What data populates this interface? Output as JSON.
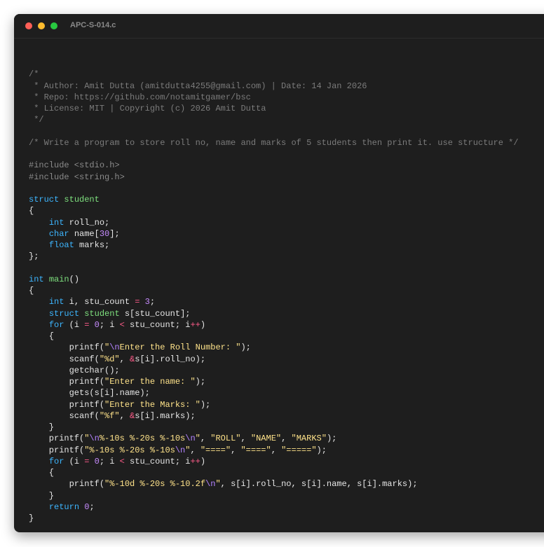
{
  "window": {
    "title": "APC-S-014.c",
    "colors": {
      "background": "#1e1e1e",
      "comment": "#7b7b7b",
      "keyword": "#3db6ff",
      "type_name": "#7ee07e",
      "number": "#c78cff",
      "operator": "#ff5c8a",
      "string": "#ffe38a",
      "escape": "#b483ff"
    }
  },
  "code_lines": [
    [],
    [
      [
        "cmt",
        "/*"
      ]
    ],
    [
      [
        "cmt",
        " * Author: Amit Dutta (amitdutta4255@gmail.com) | Date: 14 Jan 2026"
      ]
    ],
    [
      [
        "cmt",
        " * Repo: https://github.com/notamitgamer/bsc"
      ]
    ],
    [
      [
        "cmt",
        " * License: MIT | Copyright (c) 2026 Amit Dutta"
      ]
    ],
    [
      [
        "cmt",
        " */"
      ]
    ],
    [],
    [
      [
        "cmt",
        "/* Write a program to store roll no, name and marks of 5 students then print it. use structure */"
      ]
    ],
    [],
    [
      [
        "pp",
        "#include <stdio.h>"
      ]
    ],
    [
      [
        "pp",
        "#include <string.h>"
      ]
    ],
    [],
    [
      [
        "kw",
        "struct"
      ],
      [
        "plain",
        " "
      ],
      [
        "ty",
        "student"
      ]
    ],
    [
      [
        "plain",
        "{"
      ]
    ],
    [
      [
        "plain",
        "    "
      ],
      [
        "kw",
        "int"
      ],
      [
        "plain",
        " roll_no;"
      ]
    ],
    [
      [
        "plain",
        "    "
      ],
      [
        "kw",
        "char"
      ],
      [
        "plain",
        " name["
      ],
      [
        "num",
        "30"
      ],
      [
        "plain",
        "];"
      ]
    ],
    [
      [
        "plain",
        "    "
      ],
      [
        "kw",
        "float"
      ],
      [
        "plain",
        " marks;"
      ]
    ],
    [
      [
        "plain",
        "};"
      ]
    ],
    [],
    [
      [
        "kw",
        "int"
      ],
      [
        "plain",
        " "
      ],
      [
        "fn",
        "main"
      ],
      [
        "plain",
        "()"
      ]
    ],
    [
      [
        "plain",
        "{"
      ]
    ],
    [
      [
        "plain",
        "    "
      ],
      [
        "kw",
        "int"
      ],
      [
        "plain",
        " i, stu_count "
      ],
      [
        "op",
        "="
      ],
      [
        "plain",
        " "
      ],
      [
        "num",
        "3"
      ],
      [
        "plain",
        ";"
      ]
    ],
    [
      [
        "plain",
        "    "
      ],
      [
        "kw",
        "struct"
      ],
      [
        "plain",
        " "
      ],
      [
        "ty",
        "student"
      ],
      [
        "plain",
        " s[stu_count];"
      ]
    ],
    [
      [
        "plain",
        "    "
      ],
      [
        "kw",
        "for"
      ],
      [
        "plain",
        " (i "
      ],
      [
        "op",
        "="
      ],
      [
        "plain",
        " "
      ],
      [
        "num",
        "0"
      ],
      [
        "plain",
        "; i "
      ],
      [
        "op",
        "<"
      ],
      [
        "plain",
        " stu_count; i"
      ],
      [
        "op",
        "++"
      ],
      [
        "plain",
        ")"
      ]
    ],
    [
      [
        "plain",
        "    {"
      ]
    ],
    [
      [
        "plain",
        "        printf("
      ],
      [
        "str",
        "\""
      ],
      [
        "esc",
        "\\n"
      ],
      [
        "str",
        "Enter the Roll Number: \""
      ],
      [
        "plain",
        ");"
      ]
    ],
    [
      [
        "plain",
        "        scanf("
      ],
      [
        "str",
        "\"%d\""
      ],
      [
        "plain",
        ", "
      ],
      [
        "op",
        "&"
      ],
      [
        "plain",
        "s[i].roll_no);"
      ]
    ],
    [
      [
        "plain",
        "        getchar();"
      ]
    ],
    [
      [
        "plain",
        "        printf("
      ],
      [
        "str",
        "\"Enter the name: \""
      ],
      [
        "plain",
        ");"
      ]
    ],
    [
      [
        "plain",
        "        gets(s[i].name);"
      ]
    ],
    [
      [
        "plain",
        "        printf("
      ],
      [
        "str",
        "\"Enter the Marks: \""
      ],
      [
        "plain",
        ");"
      ]
    ],
    [
      [
        "plain",
        "        scanf("
      ],
      [
        "str",
        "\"%f\""
      ],
      [
        "plain",
        ", "
      ],
      [
        "op",
        "&"
      ],
      [
        "plain",
        "s[i].marks);"
      ]
    ],
    [
      [
        "plain",
        "    }"
      ]
    ],
    [
      [
        "plain",
        "    printf("
      ],
      [
        "str",
        "\""
      ],
      [
        "esc",
        "\\n"
      ],
      [
        "str",
        "%-10s %-20s %-10s"
      ],
      [
        "esc",
        "\\n"
      ],
      [
        "str",
        "\""
      ],
      [
        "plain",
        ", "
      ],
      [
        "str",
        "\"ROLL\""
      ],
      [
        "plain",
        ", "
      ],
      [
        "str",
        "\"NAME\""
      ],
      [
        "plain",
        ", "
      ],
      [
        "str",
        "\"MARKS\""
      ],
      [
        "plain",
        ");"
      ]
    ],
    [
      [
        "plain",
        "    printf("
      ],
      [
        "str",
        "\"%-10s %-20s %-10s"
      ],
      [
        "esc",
        "\\n"
      ],
      [
        "str",
        "\""
      ],
      [
        "plain",
        ", "
      ],
      [
        "str",
        "\"====\""
      ],
      [
        "plain",
        ", "
      ],
      [
        "str",
        "\"====\""
      ],
      [
        "plain",
        ", "
      ],
      [
        "str",
        "\"=====\""
      ],
      [
        "plain",
        ");"
      ]
    ],
    [
      [
        "plain",
        "    "
      ],
      [
        "kw",
        "for"
      ],
      [
        "plain",
        " (i "
      ],
      [
        "op",
        "="
      ],
      [
        "plain",
        " "
      ],
      [
        "num",
        "0"
      ],
      [
        "plain",
        "; i "
      ],
      [
        "op",
        "<"
      ],
      [
        "plain",
        " stu_count; i"
      ],
      [
        "op",
        "++"
      ],
      [
        "plain",
        ")"
      ]
    ],
    [
      [
        "plain",
        "    {"
      ]
    ],
    [
      [
        "plain",
        "        printf("
      ],
      [
        "str",
        "\"%-10d %-20s %-10.2f"
      ],
      [
        "esc",
        "\\n"
      ],
      [
        "str",
        "\""
      ],
      [
        "plain",
        ", s[i].roll_no, s[i].name, s[i].marks);"
      ]
    ],
    [
      [
        "plain",
        "    }"
      ]
    ],
    [
      [
        "plain",
        "    "
      ],
      [
        "kw",
        "return"
      ],
      [
        "plain",
        " "
      ],
      [
        "num",
        "0"
      ],
      [
        "plain",
        ";"
      ]
    ],
    [
      [
        "plain",
        "}"
      ]
    ]
  ]
}
